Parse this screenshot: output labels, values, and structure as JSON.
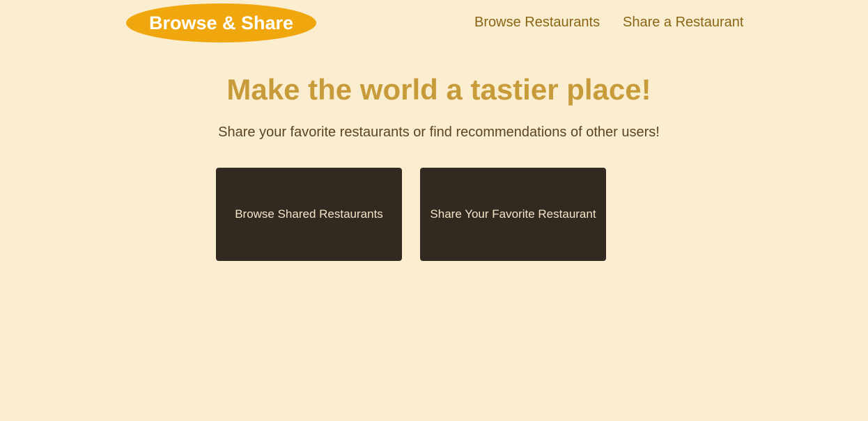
{
  "header": {
    "logo_text": "Browse & Share",
    "nav": {
      "browse_label": "Browse Restaurants",
      "share_label": "Share a Restaurant"
    }
  },
  "hero": {
    "title": "Make the world a tastier place!",
    "subtitle": "Share your favorite restaurants or find recommendations of other users!"
  },
  "actions": {
    "browse_label": "Browse Shared Restaurants",
    "share_label": "Share Your Favorite Restaurant"
  },
  "colors": {
    "background": "#fbedcf",
    "logo_bg": "#f0a70e",
    "nav_text": "#8a6515",
    "title_text": "#c89b3a",
    "subtitle_text": "#5b4425",
    "card_bg": "#322a20",
    "card_text": "#f3e4c8"
  }
}
